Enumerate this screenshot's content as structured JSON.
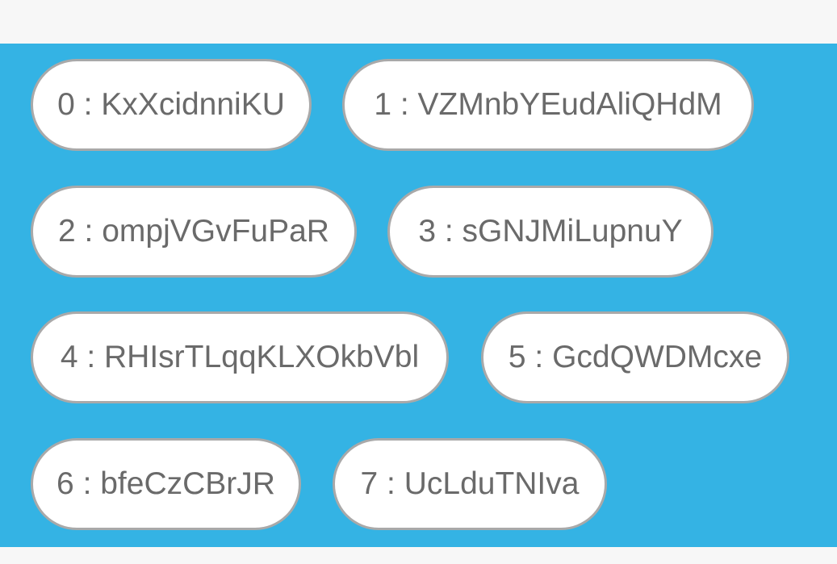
{
  "chips": [
    {
      "label": "0 : KxXcidnniKU"
    },
    {
      "label": "1 : VZMnbYEudAliQHdM"
    },
    {
      "label": "2 : ompjVGvFuPaR"
    },
    {
      "label": "3 : sGNJMiLupnuY"
    },
    {
      "label": "4 : RHIsrTLqqKLXOkbVbl"
    },
    {
      "label": "5 : GcdQWDMcxe"
    },
    {
      "label": "6 : bfeCzCBrJR"
    },
    {
      "label": "7 : UcLduTNIva"
    }
  ],
  "colors": {
    "panel_background": "#34b3e4",
    "chip_background": "#ffffff",
    "chip_border": "#a9a9a9",
    "chip_text": "#6a6a6a",
    "page_background": "#f7f7f7"
  }
}
